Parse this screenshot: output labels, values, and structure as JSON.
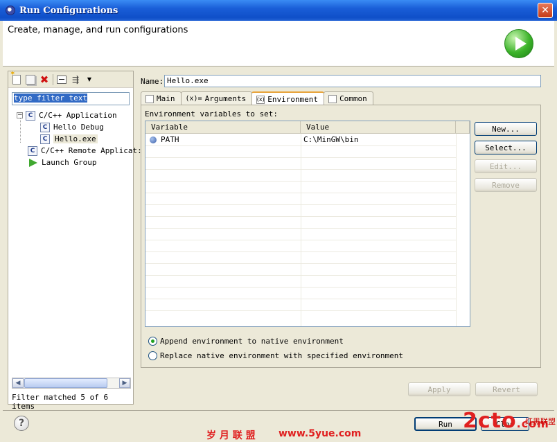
{
  "window": {
    "title": "Run Configurations",
    "close_symbol": "✕"
  },
  "header": {
    "title": "Create, manage, and run configurations"
  },
  "left_panel": {
    "filter_placeholder": "type filter text",
    "tree": {
      "root1": {
        "expander": "−",
        "label": "C/C++ Application"
      },
      "child1": {
        "label": "Hello Debug"
      },
      "child2": {
        "label": "Hello.exe"
      },
      "root2": {
        "label": "C/C++ Remote Applicat:"
      },
      "root3": {
        "label": "Launch Group"
      }
    },
    "c_icon_letter": "C",
    "status": "Filter matched 5 of 6 items",
    "scroll_left": "◀",
    "scroll_right": "▶"
  },
  "right_panel": {
    "name_label": "Name:",
    "name_value": "Hello.exe",
    "tabs": {
      "main": "Main",
      "arguments": "Arguments",
      "environment": "Environment",
      "common": "Common"
    },
    "tab_icons": {
      "arguments": "(x)=",
      "environment": "(x)"
    },
    "env": {
      "label": "Environment variables to set:",
      "columns": [
        "Variable",
        "Value"
      ],
      "rows": [
        {
          "variable": "PATH",
          "value": "C:\\MinGW\\bin"
        }
      ]
    },
    "buttons": {
      "new": "New...",
      "select": "Select...",
      "edit": "Edit...",
      "remove": "Remove",
      "apply": "Apply",
      "revert": "Revert"
    },
    "radios": {
      "append": "Append environment to native environment",
      "replace": "Replace native environment with specified environment"
    }
  },
  "footer": {
    "help": "?",
    "run": "Run",
    "close_partial": "Clos"
  },
  "watermarks": {
    "chinese": "岁 月 联 盟",
    "url": "www.5yue.com",
    "logo": "2cto",
    "logo_domain": ".com",
    "logo_sub": "红黑联盟"
  }
}
